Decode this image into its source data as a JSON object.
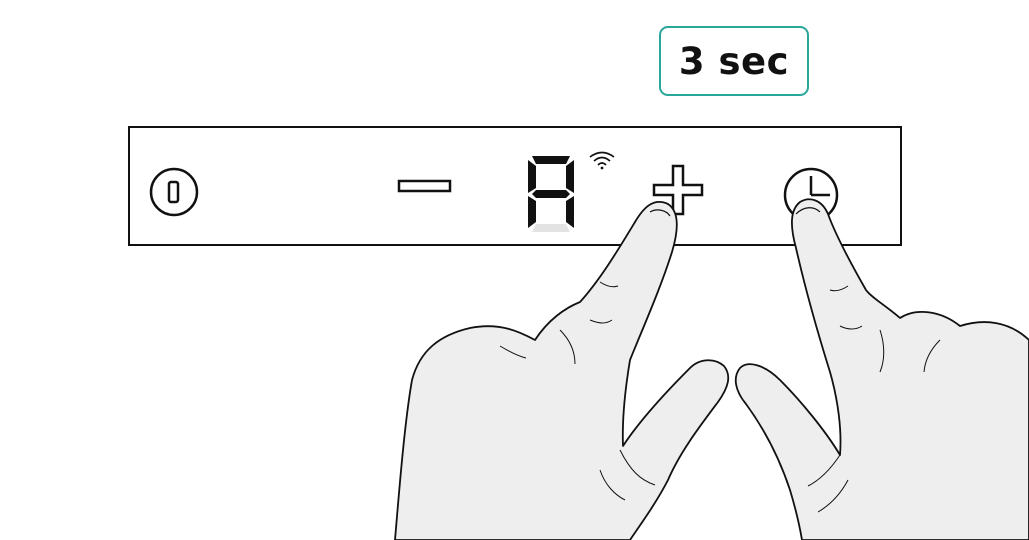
{
  "hint": {
    "duration_label": "3 sec",
    "accent_color": "#2aa79b"
  },
  "control_panel": {
    "buttons": [
      {
        "id": "power",
        "icon": "power-icon"
      },
      {
        "id": "minus",
        "icon": "minus-icon"
      },
      {
        "id": "plus",
        "icon": "plus-icon"
      },
      {
        "id": "timer",
        "icon": "timer-icon"
      }
    ],
    "display": {
      "segment_character": "A",
      "wifi_indicator": "wifi-icon"
    }
  },
  "hands": {
    "count": 2,
    "pressing": [
      "plus",
      "timer"
    ],
    "skin_color": "#eeeeee"
  }
}
